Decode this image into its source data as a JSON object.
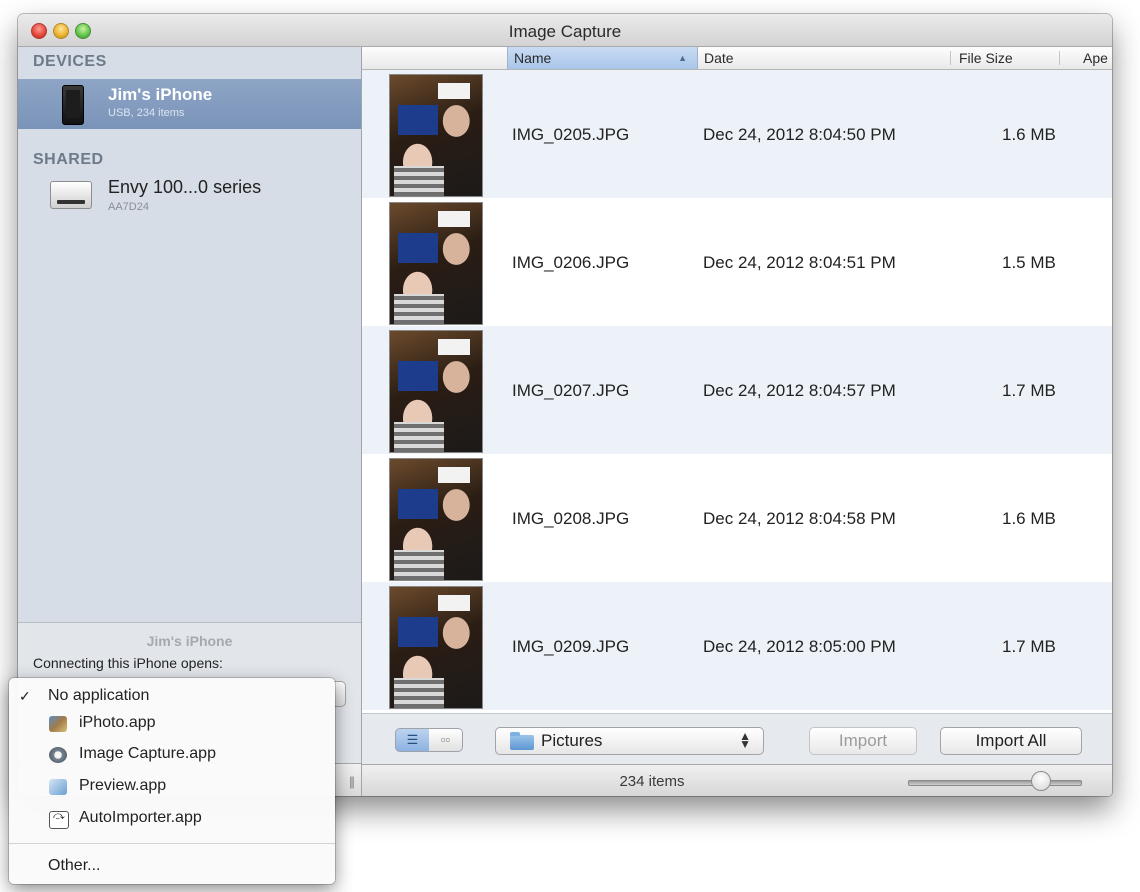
{
  "window": {
    "title": "Image Capture"
  },
  "sidebar": {
    "devices_heading": "DEVICES",
    "device": {
      "name": "Jim's iPhone",
      "subtitle": "USB, 234 items"
    },
    "shared_heading": "SHARED",
    "shared_device": {
      "name": "Envy 100...0 series",
      "subtitle": "AA7D24"
    },
    "panel_title": "Jim's iPhone",
    "panel_text": "Connecting this iPhone opens:"
  },
  "columns": {
    "name": "Name",
    "date": "Date",
    "file_size": "File Size",
    "aperture": "Ape"
  },
  "files": [
    {
      "name": "IMG_0205.JPG",
      "date": "Dec 24, 2012 8:04:50 PM",
      "size": "1.6 MB"
    },
    {
      "name": "IMG_0206.JPG",
      "date": "Dec 24, 2012 8:04:51 PM",
      "size": "1.5 MB"
    },
    {
      "name": "IMG_0207.JPG",
      "date": "Dec 24, 2012 8:04:57 PM",
      "size": "1.7 MB"
    },
    {
      "name": "IMG_0208.JPG",
      "date": "Dec 24, 2012 8:04:58 PM",
      "size": "1.6 MB"
    },
    {
      "name": "IMG_0209.JPG",
      "date": "Dec 24, 2012 8:05:00 PM",
      "size": "1.7 MB"
    }
  ],
  "toolbar": {
    "destination": "Pictures",
    "import_label": "Import",
    "import_all_label": "Import All"
  },
  "status": {
    "items": "234 items",
    "thumbnail_size_level": 0.8
  },
  "menu": {
    "items": [
      {
        "label": "No application",
        "checked": true
      },
      {
        "label": "iPhoto.app",
        "icon": "iphoto-icon"
      },
      {
        "label": "Image Capture.app",
        "icon": "image-capture-icon"
      },
      {
        "label": "Preview.app",
        "icon": "preview-icon"
      },
      {
        "label": "AutoImporter.app",
        "icon": "autoimporter-icon"
      }
    ],
    "other_label": "Other...",
    "check_mark": "✓"
  },
  "colors": {
    "selection": "#7a93b8",
    "sidebar_bg": "#d7dde6",
    "row_alt": "#edf2f8"
  }
}
